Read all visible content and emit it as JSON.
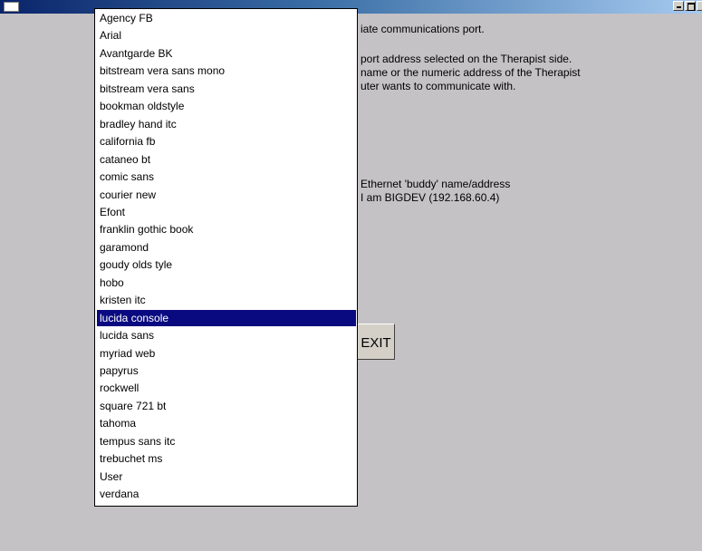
{
  "window": {
    "sysmenu_icon": "window-icon",
    "caption_buttons": [
      "minimize-icon",
      "maximize-icon",
      "close-icon"
    ]
  },
  "instructions": [
    "iate communications port.",
    "",
    "port address selected on the Therapist side.",
    " name or the numeric address of the Therapist",
    "uter wants to communicate with.",
    "",
    "",
    "",
    "",
    "",
    " Ethernet 'buddy' name/address",
    " I am BIGDEV (192.168.60.4)"
  ],
  "exit_button": {
    "label": "EXIT"
  },
  "font_list": {
    "selected": "lucida console",
    "items": [
      "Agency FB",
      "Arial",
      "Avantgarde BK",
      "bitstream vera sans mono",
      "bitstream vera sans",
      "bookman oldstyle",
      "bradley hand itc",
      "california fb",
      "cataneo bt",
      "comic sans",
      "courier new",
      "Efont",
      "franklin gothic book",
      "garamond",
      "goudy olds tyle",
      "hobo",
      "kristen itc",
      "lucida console",
      "lucida sans",
      "myriad web",
      "papyrus",
      "rockwell",
      "square 721 bt",
      "tahoma",
      "tempus sans itc",
      "trebuchet ms",
      "User",
      "verdana"
    ]
  },
  "colors": {
    "background": "#c4c2c5",
    "selection": "#0a0a80",
    "titlebar_start": "#0a246a",
    "titlebar_end": "#a6caf0"
  }
}
